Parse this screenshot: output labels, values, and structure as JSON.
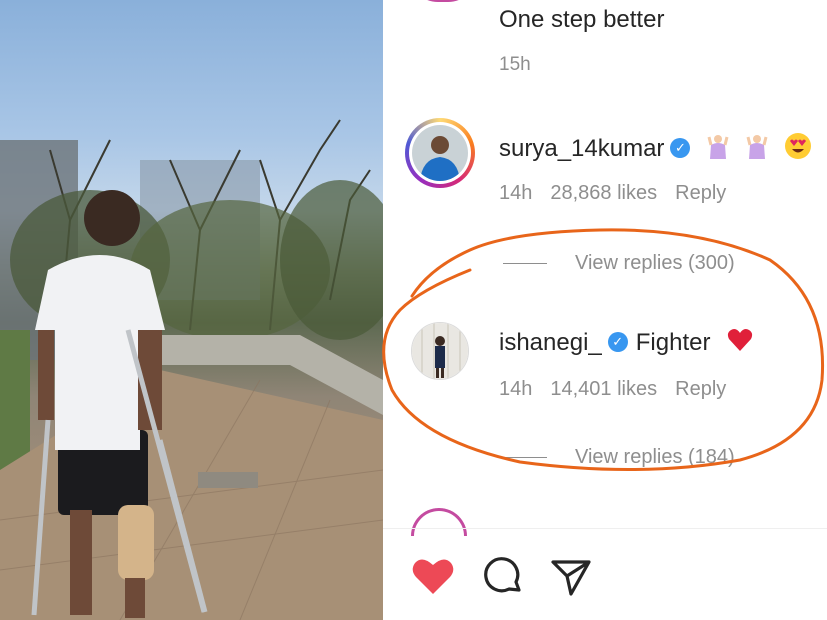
{
  "post": {
    "previous_comment": {
      "text": "One step better",
      "time": "15h"
    },
    "comments": [
      {
        "username": "surya_14kumar",
        "verified": true,
        "text": "",
        "emoji": [
          "person-raising-hands-emoji",
          "person-raising-hands-emoji",
          "heart-eyes-emoji"
        ],
        "time": "14h",
        "likes": "28,868 likes",
        "reply_label": "Reply",
        "view_replies": "View replies (300)"
      },
      {
        "username": "ishanegi_",
        "verified": true,
        "text": "Fighter",
        "emoji": [
          "red-heart-emoji"
        ],
        "time": "14h",
        "likes": "14,401 likes",
        "reply_label": "Reply",
        "view_replies": "View replies (184)"
      }
    ]
  },
  "actions": [
    {
      "icon": "heart-icon",
      "state": "liked"
    },
    {
      "icon": "comment-icon"
    },
    {
      "icon": "share-icon"
    }
  ],
  "colors": {
    "like_red": "#ed4956",
    "verified_blue": "#3897f0",
    "annotation_orange": "#e8651a",
    "muted_text": "#8e8e8e"
  }
}
